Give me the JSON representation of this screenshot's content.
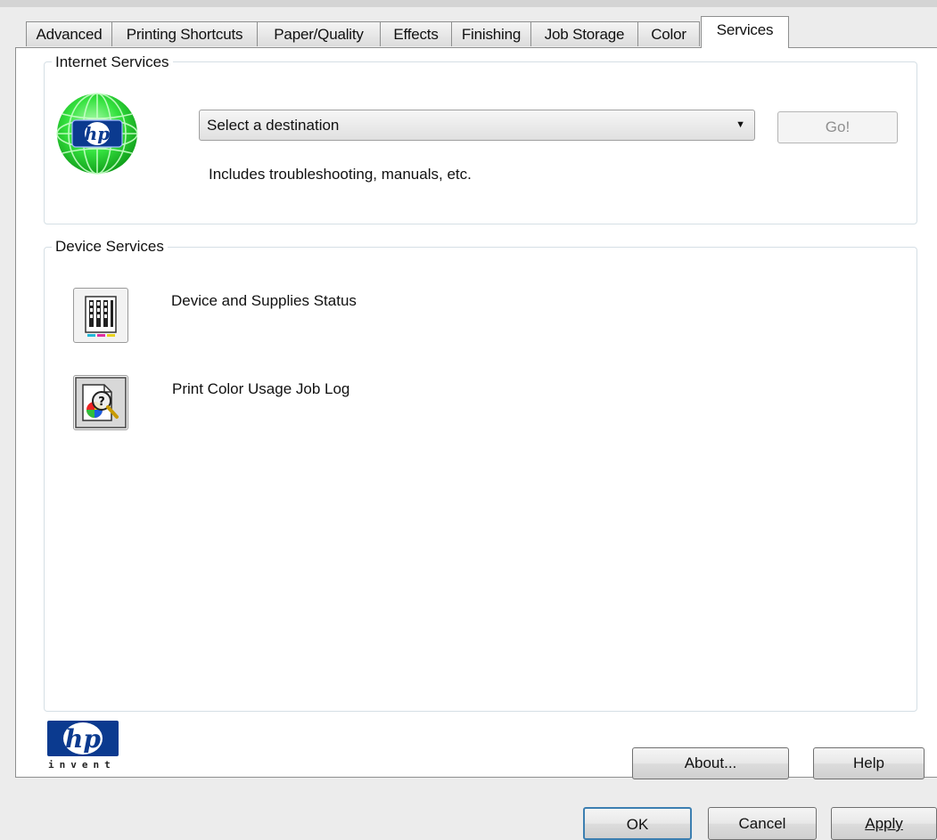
{
  "tabs": [
    {
      "label": "Advanced",
      "active": false
    },
    {
      "label": "Printing Shortcuts",
      "active": false
    },
    {
      "label": "Paper/Quality",
      "active": false
    },
    {
      "label": "Effects",
      "active": false
    },
    {
      "label": "Finishing",
      "active": false
    },
    {
      "label": "Job Storage",
      "active": false
    },
    {
      "label": "Color",
      "active": false
    },
    {
      "label": "Services",
      "active": true
    }
  ],
  "internet_services": {
    "title": "Internet Services",
    "select_value": "Select a destination",
    "go_label": "Go!",
    "go_enabled": false,
    "description": "Includes troubleshooting, manuals, etc."
  },
  "device_services": {
    "title": "Device Services",
    "items": [
      {
        "label": "Device and Supplies Status",
        "icon": "supplies-status-icon"
      },
      {
        "label": "Print Color Usage Job Log",
        "icon": "color-usage-log-icon"
      }
    ]
  },
  "logo": {
    "tagline": "invent"
  },
  "panel_buttons": {
    "about": "About...",
    "help": "Help"
  },
  "dialog_buttons": {
    "ok": "OK",
    "cancel": "Cancel",
    "apply": "Apply"
  },
  "colors": {
    "hp_blue": "#0b3a8f",
    "globe_green": "#2fe03a"
  }
}
